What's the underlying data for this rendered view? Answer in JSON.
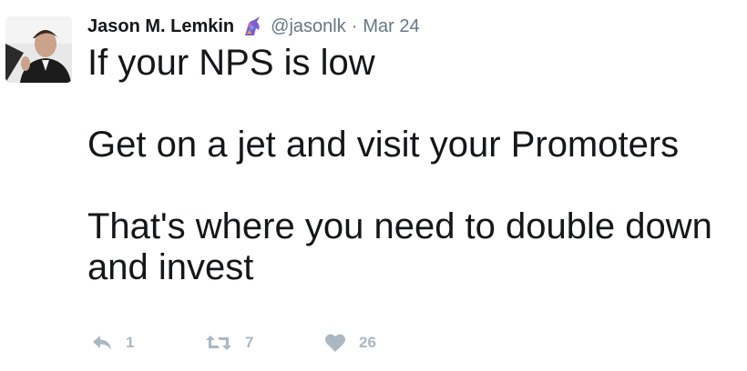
{
  "user": {
    "name": "Jason M. Lemkin",
    "handle": "@jasonlk",
    "separator": "·",
    "date": "Mar 24",
    "badge_icon": "unicorn-icon"
  },
  "tweet": {
    "text": "If your NPS is low\n\nGet on a jet and visit your Promoters\n\nThat's where you need to double down\nand invest"
  },
  "actions": {
    "reply_count": "1",
    "retweet_count": "7",
    "like_count": "26"
  },
  "colors": {
    "text": "#14171a",
    "secondary": "#657786",
    "action": "#aab8c2"
  }
}
